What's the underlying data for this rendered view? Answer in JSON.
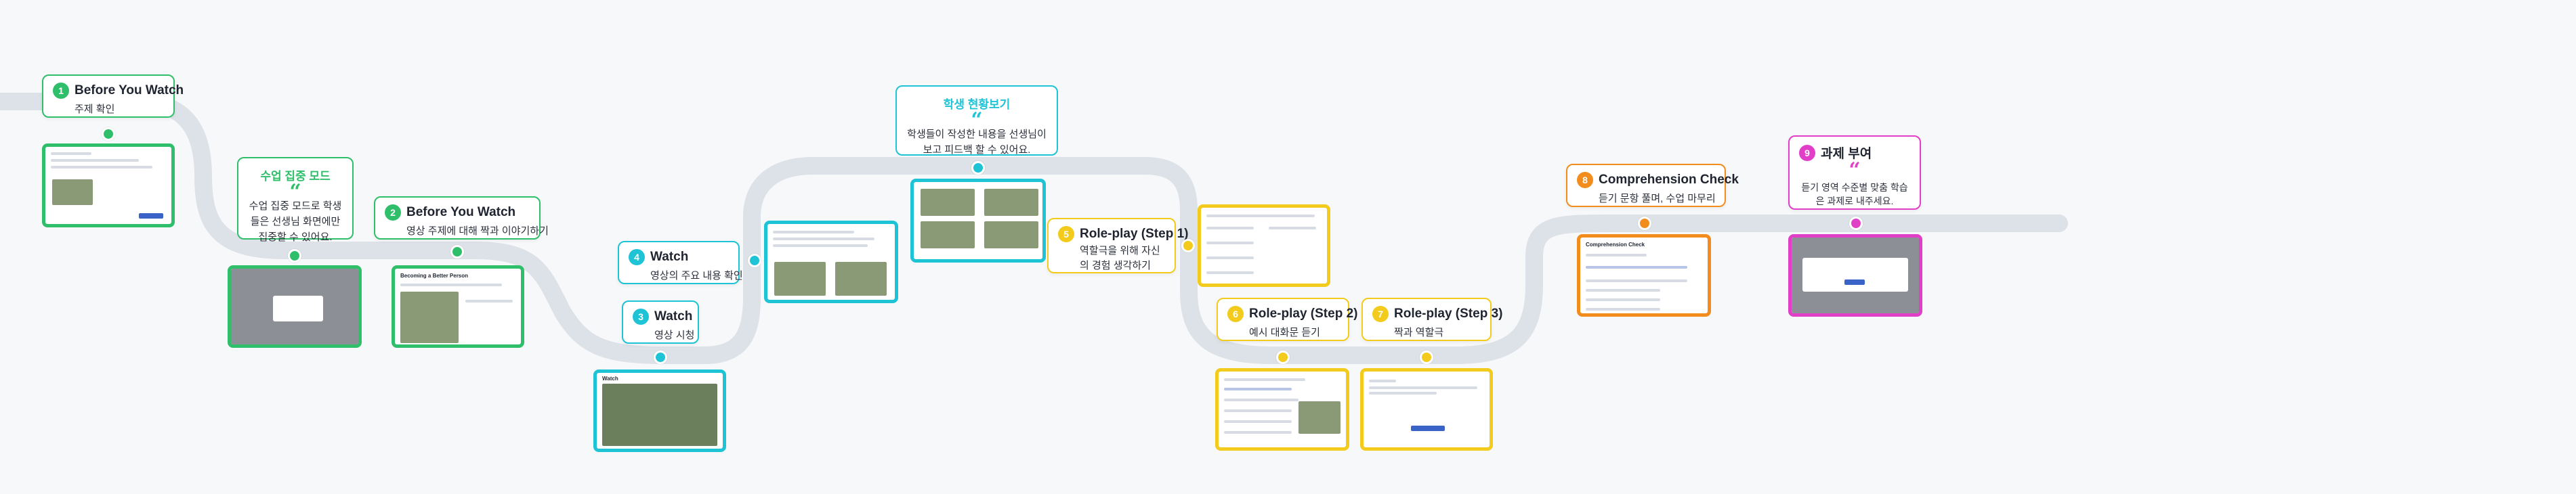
{
  "colors": {
    "green": "#2fbf6a",
    "cyan": "#1fc3d6",
    "yellow": "#f2cb1d",
    "orange": "#f28c1d",
    "magenta": "#e23fc8",
    "road": "#dde1e8"
  },
  "steps": [
    {
      "num": "1",
      "title": "Before You Watch",
      "sub": "주제 확인"
    },
    {
      "num": "2",
      "title": "Before You Watch",
      "sub": "영상 주제에 대해 짝과 이야기하기"
    },
    {
      "num": "3",
      "title": "Watch",
      "sub": "영상 시청"
    },
    {
      "num": "4",
      "title": "Watch",
      "sub": "영상의 주요 내용 확인"
    },
    {
      "num": "5",
      "title": "Role-play (Step 1)",
      "sub": "역할극을 위해 자신의 경험 생각하기"
    },
    {
      "num": "6",
      "title": "Role-play (Step 2)",
      "sub": "예시 대화문 듣기"
    },
    {
      "num": "7",
      "title": "Role-play (Step 3)",
      "sub": "짝과 역할극"
    },
    {
      "num": "8",
      "title": "Comprehension Check",
      "sub": "듣기 문항 풀며, 수업 마무리"
    },
    {
      "num": "9",
      "title": "과제 부여",
      "sub": "듣기 영역 수준별 맞춤 학습은 과제로 내주세요."
    }
  ],
  "notes": {
    "focus": {
      "title": "수업 집중 모드",
      "quote": "“",
      "body": "수업 집중 모드로 학생들은 선생님 화면에만 집중할 수 있어요."
    },
    "status": {
      "title": "학생 현황보기",
      "quote": "“",
      "body": "학생들이 작성한 내용을 선생님이 보고 피드백 할 수 있어요."
    }
  },
  "screens": {
    "s1": {
      "title": "Before You Watch"
    },
    "s2": {
      "title": "Becoming a Better Person"
    },
    "s3": {
      "title": "Watch"
    },
    "s8": {
      "title": "Comprehension Check"
    }
  }
}
